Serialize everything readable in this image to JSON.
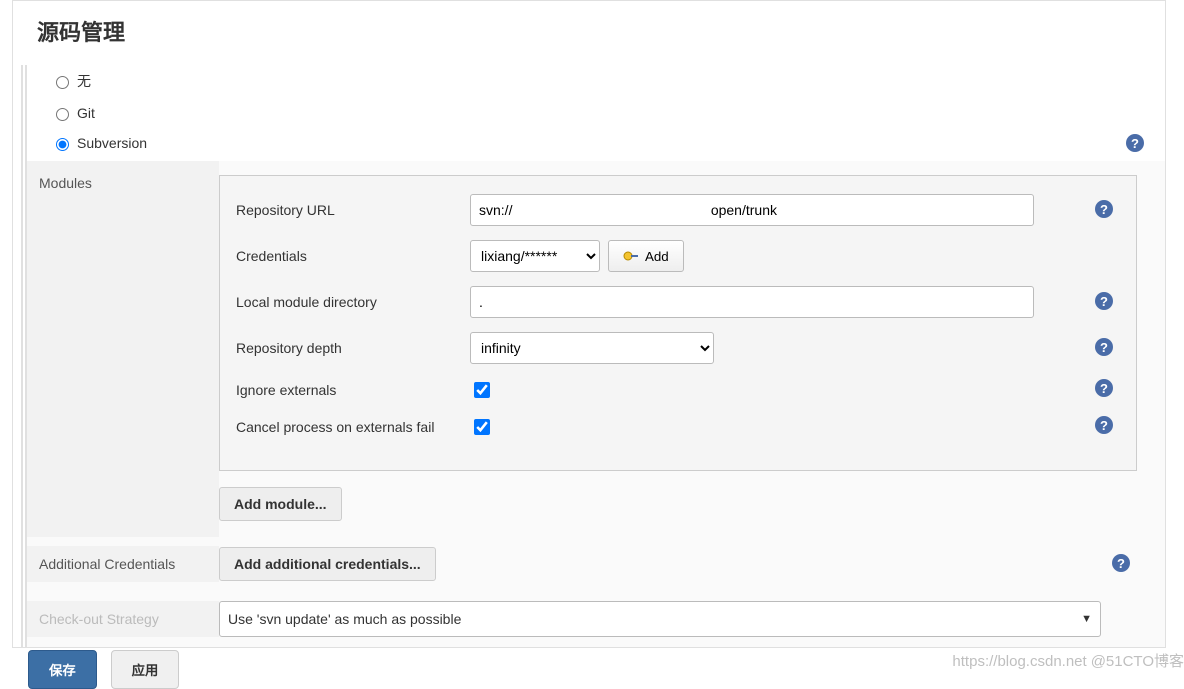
{
  "section_title": "源码管理",
  "scm_options": {
    "none": "无",
    "git": "Git",
    "svn": "Subversion"
  },
  "modules_label": "Modules",
  "fields": {
    "repo_url": {
      "label": "Repository URL",
      "value": "svn://                                                   open/trunk"
    },
    "credentials": {
      "label": "Credentials",
      "selected": "lixiang/******",
      "add_button": "Add"
    },
    "local_dir": {
      "label": "Local module directory",
      "value": "."
    },
    "repo_depth": {
      "label": "Repository depth",
      "selected": "infinity"
    },
    "ignore_ext": {
      "label": "Ignore externals",
      "checked": true
    },
    "cancel_ext": {
      "label": "Cancel process on externals fail",
      "checked": true
    }
  },
  "add_module_button": "Add module...",
  "additional_credentials": {
    "label": "Additional Credentials",
    "button": "Add additional credentials..."
  },
  "checkout_strategy": {
    "label": "Check-out Strategy",
    "selected": "Use 'svn update' as much as possible"
  },
  "footer": {
    "save": "保存",
    "apply": "应用"
  },
  "watermarks": {
    "csdn": "https://blog.csdn.net",
    "cto": "@51CTO博客"
  }
}
